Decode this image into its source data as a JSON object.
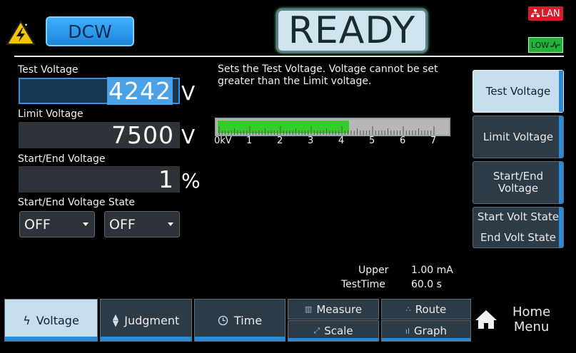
{
  "header": {
    "mode": "DCW",
    "status": "READY",
    "lan_badge": "LAN",
    "low_badge": "LOW"
  },
  "settings": {
    "test_voltage": {
      "label": "Test Voltage",
      "value": "4242",
      "unit": "V"
    },
    "limit_voltage": {
      "label": "Limit Voltage",
      "value": "7500",
      "unit": "V"
    },
    "start_end_voltage": {
      "label": "Start/End Voltage",
      "value": "1",
      "unit": "%"
    },
    "start_end_state": {
      "label": "Start/End Voltage State",
      "start_value": "OFF",
      "end_value": "OFF"
    }
  },
  "description": "Sets the Test Voltage. Voltage cannot be set greater than the Limit voltage.",
  "voltage_bar": {
    "scale_labels": [
      "0kV",
      "1",
      "2",
      "3",
      "4",
      "5",
      "6",
      "7"
    ],
    "fraction": 0.57,
    "fill_color": "#33cc2a"
  },
  "side_buttons": [
    {
      "label": "Test Voltage",
      "selected": true
    },
    {
      "label": "Limit Voltage",
      "selected": false
    },
    {
      "label_line1": "Start/End",
      "label_line2": "Voltage",
      "selected": false
    },
    {
      "label_line1": "Start Volt State",
      "label_line2": "End Volt State",
      "selected": false
    }
  ],
  "info": {
    "upper_label": "Upper",
    "upper_value": "1.00 mA",
    "testtime_label": "TestTime",
    "testtime_value": "60.0 s"
  },
  "tabs": {
    "voltage": "Voltage",
    "judgment": "Judgment",
    "time": "Time",
    "measure": "Measure",
    "scale": "Scale",
    "route": "Route",
    "graph": "Graph"
  },
  "home": {
    "line1": "Home",
    "line2": "Menu"
  },
  "icons": {
    "hv": "high-voltage-warning-icon",
    "home": "home-icon"
  },
  "colors": {
    "accent_blue": "#2a8ad8",
    "lan_red": "#d61e2a",
    "low_green": "#24b03c"
  }
}
